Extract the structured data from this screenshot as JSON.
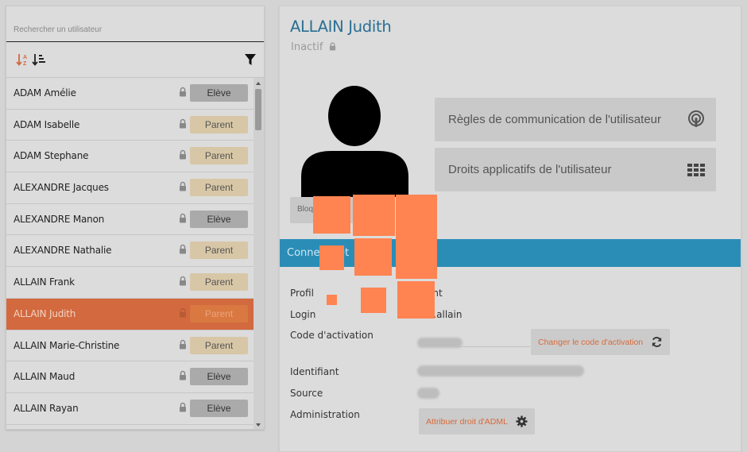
{
  "search": {
    "placeholder": "Rechercher un utilisateur"
  },
  "toolbar": {
    "sort_alpha_icon": "sort-alpha-asc-icon",
    "sort_num_icon": "sort-amount-icon",
    "filter_icon": "filter-icon"
  },
  "users": [
    {
      "name": "ADAM Amélie",
      "role": "Elève",
      "type": "eleve"
    },
    {
      "name": "ADAM Isabelle",
      "role": "Parent",
      "type": "parent"
    },
    {
      "name": "ADAM Stephane",
      "role": "Parent",
      "type": "parent"
    },
    {
      "name": "ALEXANDRE Jacques",
      "role": "Parent",
      "type": "parent"
    },
    {
      "name": "ALEXANDRE Manon",
      "role": "Elève",
      "type": "eleve"
    },
    {
      "name": "ALEXANDRE Nathalie",
      "role": "Parent",
      "type": "parent"
    },
    {
      "name": "ALLAIN Frank",
      "role": "Parent",
      "type": "parent"
    },
    {
      "name": "ALLAIN Judith",
      "role": "Parent",
      "type": "parent",
      "selected": true
    },
    {
      "name": "ALLAIN Marie-Christine",
      "role": "Parent",
      "type": "parent"
    },
    {
      "name": "ALLAIN Maud",
      "role": "Elève",
      "type": "eleve"
    },
    {
      "name": "ALLAIN Rayan",
      "role": "Elève",
      "type": "eleve"
    }
  ],
  "detail": {
    "title": "ALLAIN Judith",
    "status": "Inactif",
    "block_label": "Bloq",
    "communication_button": "Règles de communication de l'utilisateur",
    "rights_button": "Droits applicatifs de l'utilisateur",
    "section_title": "Conne",
    "section_title_tail": "et",
    "fields": {
      "profil_label": "Profil",
      "profil_value": "ent",
      "login_label": "Login",
      "login_value": "th.allain",
      "activation_label": "Code d'activation",
      "identifiant_label": "Identifiant",
      "source_label": "Source",
      "administration_label": "Administration"
    },
    "change_code_button": "Changer le code d'activation",
    "adml_button": "Attribuer droit d'ADML"
  },
  "colors": {
    "accent_blue": "#2a8db6",
    "title_blue": "#2a6f93",
    "selected_row": "#d2693f",
    "parent_badge": "#d8c7a6",
    "eleve_badge": "#aaaaaa",
    "action_text": "#d86a3a",
    "mask_orange": "#ff8452"
  }
}
